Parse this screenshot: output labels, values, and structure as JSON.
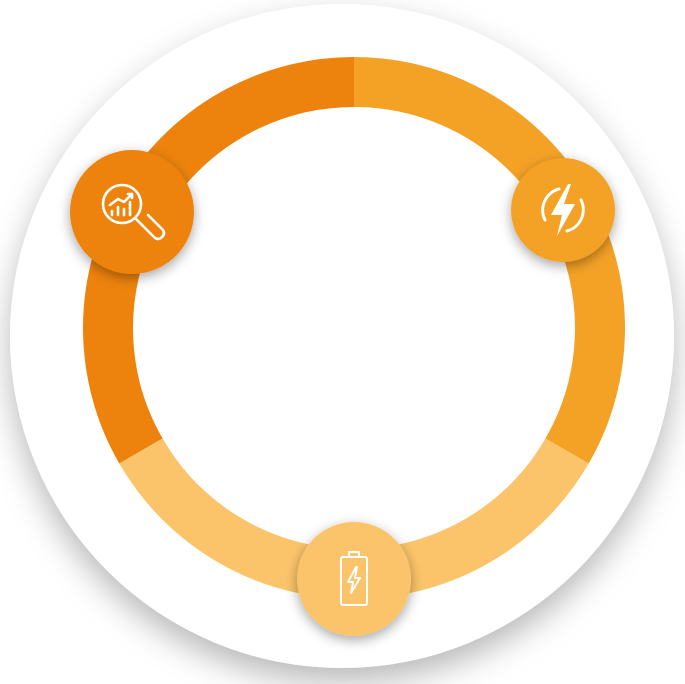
{
  "colors": {
    "background": "#ffffff",
    "disc": "#ffffff",
    "segment_top_left": "#ED830C",
    "segment_top_right": "#F4A226",
    "segment_bottom": "#FCC46A",
    "icon_stroke": "#ffffff"
  },
  "cycle": {
    "segments": [
      {
        "id": "top-left",
        "color": "#ED830C"
      },
      {
        "id": "top-right",
        "color": "#F4A226"
      },
      {
        "id": "bottom",
        "color": "#FCC46A"
      }
    ],
    "nodes": [
      {
        "id": "analytics",
        "icon": "magnifier-chart-icon",
        "color": "#ED830C"
      },
      {
        "id": "power",
        "icon": "lightning-circle-icon",
        "color": "#F4A226"
      },
      {
        "id": "battery",
        "icon": "battery-charging-icon",
        "color": "#FCC46A"
      }
    ]
  }
}
